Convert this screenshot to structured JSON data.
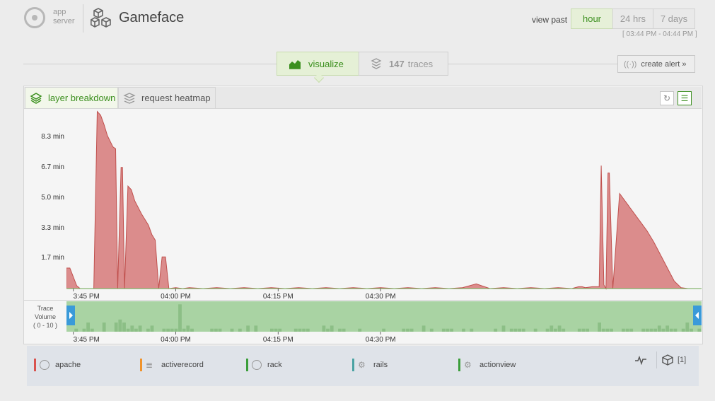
{
  "header": {
    "app_label_line1": "app",
    "app_label_line2": "server",
    "title": "Gameface",
    "view_past_label": "view past",
    "ranges": [
      "hour",
      "24 hrs",
      "7 days"
    ],
    "selected_range": "hour",
    "time_window": "[ 03:44 PM - 04:44 PM ]"
  },
  "tabs": {
    "visualize": "visualize",
    "traces_count": "147",
    "traces_label": "traces"
  },
  "create_alert": "create alert »",
  "panel": {
    "tab_layer": "layer breakdown",
    "tab_heatmap": "request heatmap"
  },
  "volume_label": {
    "line1": "Trace",
    "line2": "Volume",
    "line3": "( 0 - 10 )"
  },
  "legend": [
    {
      "name": "apache",
      "color": "#d9534f",
      "icon": "globe-icon"
    },
    {
      "name": "activerecord",
      "color": "#f0932b",
      "icon": "database-icon"
    },
    {
      "name": "rack",
      "color": "#3b9e3b",
      "icon": "globe-icon"
    },
    {
      "name": "rails",
      "color": "#4aa3a3",
      "icon": "gears-icon"
    },
    {
      "name": "actionview",
      "color": "#3b9e3b",
      "icon": "gears-icon"
    }
  ],
  "footer": {
    "cube_count": "[1]"
  },
  "colors": {
    "accent": "#3b8f1e",
    "area_fill": "#db8c8c",
    "area_stroke": "#c0504d",
    "volume_bg": "#a9d3a3",
    "volume_bar": "#8cbf86",
    "handle": "#3a9ad9"
  },
  "chart_data": [
    {
      "type": "area",
      "title": "",
      "xlabel": "",
      "ylabel": "",
      "x_ticks": [
        "3:45 PM",
        "04:00 PM",
        "04:15 PM",
        "04:30 PM"
      ],
      "y_ticks": [
        "1.7 min",
        "3.3 min",
        "5.0 min",
        "6.7 min",
        "8.3 min"
      ],
      "ylim_min": [
        0,
        9.6
      ],
      "series": [
        {
          "x_min": [
            44,
            44.5,
            45.5,
            46,
            47,
            48,
            48.5,
            49,
            49.5,
            50,
            50.8,
            51.2,
            51.5,
            52,
            52.2,
            52.5,
            53,
            53.5,
            54,
            55,
            56,
            56.5,
            57,
            57.5,
            58,
            58.5,
            59,
            60,
            61,
            62,
            64,
            66,
            68,
            70,
            72,
            74,
            76,
            78,
            80,
            82,
            84,
            86,
            88,
            90,
            92,
            94,
            96,
            98,
            100,
            102,
            104,
            106,
            108,
            110,
            112,
            114,
            116,
            118,
            119,
            119.5,
            120,
            121,
            122,
            122.3,
            122.7,
            123,
            123.3,
            123.5,
            124,
            125,
            126,
            127,
            128,
            129,
            130,
            131,
            132,
            133,
            134,
            135,
            136
          ],
          "values": [
            1.1,
            1.1,
            0.15,
            0,
            0,
            0,
            9.5,
            9.3,
            8.8,
            8.2,
            7.6,
            7.5,
            0,
            6.5,
            6.5,
            0,
            5.5,
            5.3,
            4.7,
            4.0,
            3.4,
            2.9,
            2.6,
            0,
            1.7,
            1.7,
            0,
            0.05,
            0,
            0.05,
            0,
            0.05,
            0,
            0.05,
            0,
            0.05,
            0,
            0.05,
            0,
            0.05,
            0,
            0.05,
            0,
            0.05,
            0,
            0.05,
            0,
            0.05,
            0,
            0.05,
            0.25,
            0,
            0.05,
            0,
            0.05,
            0,
            0.05,
            0,
            0.1,
            0.1,
            0.05,
            0.1,
            0.1,
            6.6,
            0.2,
            0,
            6.2,
            6.2,
            0,
            5.1,
            4.6,
            4.1,
            3.6,
            3.1,
            2.5,
            1.8,
            1.1,
            0.4,
            0.05,
            0,
            0
          ]
        }
      ]
    },
    {
      "type": "bar",
      "title": "",
      "xlabel": "",
      "ylabel": "Trace Volume",
      "x_ticks": [
        "3:45 PM",
        "04:00 PM",
        "04:15 PM",
        "04:30 PM"
      ],
      "ylim": [
        0,
        10
      ],
      "values": [
        0,
        0,
        1,
        0,
        1,
        3,
        1,
        0,
        0,
        3,
        0,
        0,
        3,
        4,
        3,
        1,
        2,
        1,
        2,
        0,
        1,
        2,
        0,
        0,
        1,
        1,
        1,
        1,
        9,
        1,
        2,
        1,
        0,
        0,
        0,
        0,
        1,
        1,
        1,
        0,
        0,
        1,
        0,
        1,
        0,
        2,
        0,
        2,
        0,
        0,
        0,
        1,
        1,
        1,
        0,
        0,
        0,
        1,
        1,
        1,
        1,
        0,
        0,
        0,
        2,
        1,
        2,
        0,
        1,
        1,
        0,
        0,
        0,
        1,
        0,
        0,
        0,
        0,
        0,
        1,
        0,
        0,
        0,
        0,
        1,
        1,
        1,
        0,
        0,
        2,
        0,
        1,
        0,
        0,
        1,
        1,
        1,
        0,
        0,
        1,
        0,
        1,
        0,
        0,
        0,
        0,
        0,
        1,
        0,
        2,
        0,
        1,
        1,
        1,
        1,
        0,
        0,
        1,
        0,
        0,
        1,
        2,
        1,
        2,
        1,
        0,
        0,
        0,
        1,
        1,
        1,
        0,
        0,
        3,
        1,
        1,
        1,
        0,
        0,
        1,
        1,
        1,
        0,
        0,
        1,
        1,
        1,
        1,
        2,
        1,
        2,
        1,
        1,
        0,
        1,
        3,
        1,
        0,
        1
      ]
    }
  ]
}
